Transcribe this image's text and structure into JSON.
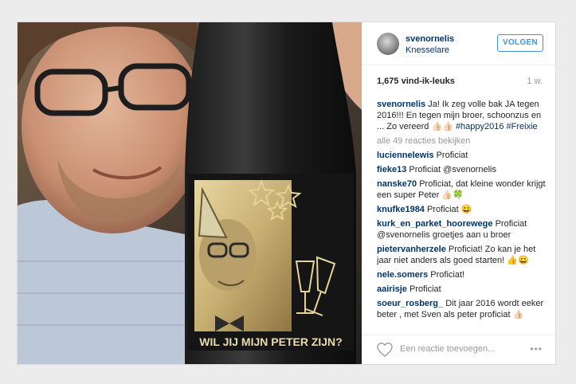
{
  "post": {
    "header": {
      "username": "svenornelis",
      "location": "Knesselare",
      "follow_label": "VOLGEN"
    },
    "photo": {
      "bottle_label_text": "WIL JIJ MIJN PETER ZIJN?"
    },
    "likes_text": "1,675 vind-ik-leuks",
    "age_text": "1 w.",
    "caption": {
      "user": "svenornelis",
      "text": "Ja! Ik zeg volle bak JA tegen 2016!!! En tegen mijn broer, schoonzus en ... Zo vereerd 👍🏻👍🏻",
      "hashtags": "#happy2016 #Freixie"
    },
    "view_all_comments": "alle 49 reacties bekijken",
    "comments": [
      {
        "user": "luciennelewis",
        "text": "Proficiat"
      },
      {
        "user": "fieke13",
        "text": "Proficiat @svenornelis"
      },
      {
        "user": "nanske70",
        "text": "Proficiat, dat kleine wonder krijgt een super Peter 👍🏻🍀"
      },
      {
        "user": "knufke1984",
        "text": "Proficiat 😀"
      },
      {
        "user": "kurk_en_parket_hoorewege",
        "text": "Proficiat @svenornelis groetjes aan u broer"
      },
      {
        "user": "pietervanherzele",
        "text": "Proficiat! Zo kan je het jaar niet anders als goed starten! 👍😀"
      },
      {
        "user": "nele.somers",
        "text": "Proficiat!"
      },
      {
        "user": "aairisje",
        "text": "Proficiat"
      },
      {
        "user": "soeur_rosberg_",
        "text": "Dit jaar 2016 wordt eeker beter , met Sven als peter proficiat 👍🏻"
      }
    ],
    "add_comment_placeholder": "Een reactie toevoegen...",
    "more_icon": "more-options-icon",
    "like_icon": "heart-icon",
    "colors": {
      "link": "#003569",
      "follow": "#3897f0",
      "muted": "#999999"
    }
  }
}
